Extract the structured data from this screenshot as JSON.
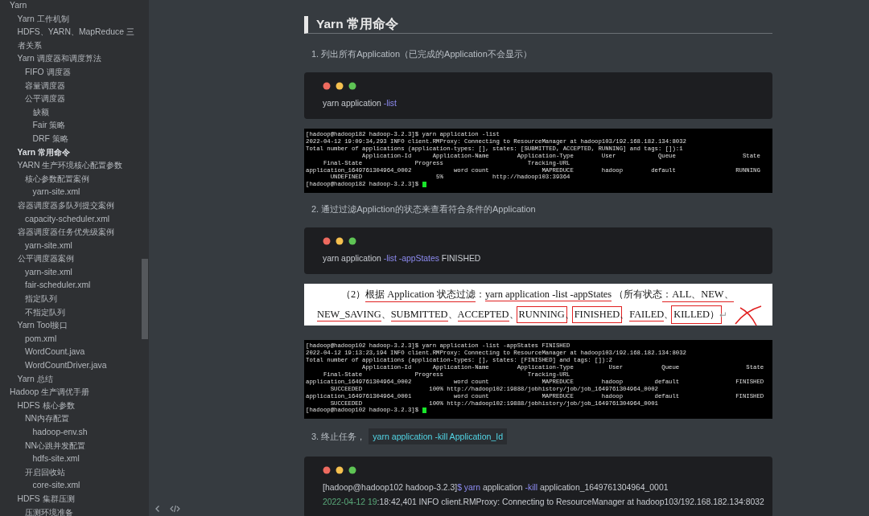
{
  "sidebar": {
    "items": [
      {
        "text": "Yarn",
        "selected": false,
        "children": [
          {
            "text": "Yarn 工作机制",
            "selected": false
          },
          {
            "text": "HDFS、YARN、MapReduce 三者关系",
            "selected": false
          },
          {
            "text": "Yarn 调度器和调度算法",
            "selected": false,
            "children": [
              {
                "text": "FIFO 调度器",
                "selected": false
              },
              {
                "text": "容量调度器",
                "selected": false
              },
              {
                "text": "公平调度器",
                "selected": false,
                "children": [
                  {
                    "text": "缺额",
                    "selected": false
                  },
                  {
                    "text": "Fair 策略",
                    "selected": false
                  },
                  {
                    "text": "DRF 策略",
                    "selected": false
                  }
                ]
              }
            ]
          },
          {
            "text": "Yarn 常用命令",
            "selected": true
          },
          {
            "text": "YARN 生产环境核心配置参数",
            "selected": false,
            "children": [
              {
                "text": "核心参数配置案例",
                "selected": false,
                "children": [
                  {
                    "text": "yarn-site.xml",
                    "selected": false
                  }
                ]
              }
            ]
          },
          {
            "text": "容器调度器多队列提交案例",
            "selected": false,
            "children": [
              {
                "text": "capacity-scheduler.xml",
                "selected": false
              }
            ]
          },
          {
            "text": "容器调度器任务优先级案例",
            "selected": false,
            "children": [
              {
                "text": "yarn-site.xml",
                "selected": false
              }
            ]
          },
          {
            "text": "公平调度器案例",
            "selected": false,
            "children": [
              {
                "text": "yarn-site.xml",
                "selected": false
              },
              {
                "text": "fair-scheduler.xml",
                "selected": false
              },
              {
                "text": "指定队列",
                "selected": false
              },
              {
                "text": "不指定队列",
                "selected": false
              }
            ]
          },
          {
            "text": "Yarn Tool接口",
            "selected": false,
            "children": [
              {
                "text": "pom.xml",
                "selected": false
              },
              {
                "text": "WordCount.java",
                "selected": false
              },
              {
                "text": "WordCountDriver.java",
                "selected": false
              }
            ]
          },
          {
            "text": "Yarn 总结",
            "selected": false
          }
        ]
      },
      {
        "text": "Hadoop 生产调优手册",
        "selected": false,
        "children": [
          {
            "text": "HDFS 核心参数",
            "selected": false,
            "children": [
              {
                "text": "NN内存配置",
                "selected": false,
                "children": [
                  {
                    "text": "hadoop-env.sh",
                    "selected": false
                  }
                ]
              },
              {
                "text": "NN心跳并发配置",
                "selected": false,
                "children": [
                  {
                    "text": "hdfs-site.xml",
                    "selected": false
                  }
                ]
              },
              {
                "text": "开启回收站",
                "selected": false,
                "children": [
                  {
                    "text": "core-site.xml",
                    "selected": false
                  }
                ]
              }
            ]
          },
          {
            "text": "HDFS 集群压测",
            "selected": false,
            "children": [
              {
                "text": "压测环境准备",
                "selected": false
              }
            ]
          }
        ]
      }
    ]
  },
  "document": {
    "blocks": [
      {
        "kind": "heading",
        "text": "Yarn 常用命令"
      },
      {
        "kind": "list_item",
        "text": "1. 列出所有Application（已完成的Application不会显示）"
      },
      {
        "kind": "code_block",
        "lines": [
          [
            {
              "text": "yarn application ",
              "kind": "plain"
            },
            {
              "text": "-list",
              "kind": "keyword"
            }
          ]
        ]
      },
      {
        "kind": "terminal",
        "cursor": true,
        "lines": [
          "[hadoop@hadoop182 hadoop-3.2.3]$ yarn application -list",
          "2022-04-12 19:09:34,293 INFO client.RMProxy: Connecting to ResourceManager at hadoop103/192.168.182.134:8032",
          "Total number of applications (application-types: [], states: [SUBMITTED, ACCEPTED, RUNNING] and tags: []):1",
          "                Application-Id      Application-Name        Application-Type        User            Queue                   State",
          "     Final-State               Progress                        Tracking-URL",
          "application_1649761304964_0002            word count               MAPREDUCE        hadoop        default                 RUNNING",
          "       UNDEFINED                     5%              http://hadoop103:39364",
          "[hadoop@hadoop182 hadoop-3.2.3]$ "
        ]
      },
      {
        "kind": "list_item",
        "text": "2. 通过过滤Appliction的状态来查看符合条件的Application"
      },
      {
        "kind": "code_block",
        "lines": [
          [
            {
              "text": "yarn application ",
              "kind": "plain"
            },
            {
              "text": "-list -appStates",
              "kind": "keyword"
            },
            {
              "text": " FINISHED",
              "kind": "plain"
            }
          ]
        ]
      },
      {
        "kind": "scanned_text",
        "cross": true,
        "lines": [
          [
            {
              "text": "（2）",
              "kind": "plain"
            },
            {
              "text": "根据 Application 状态过滤",
              "kind": "underlined"
            },
            {
              "text": "：",
              "kind": "plain"
            },
            {
              "text": "yarn application -list -appStates",
              "kind": "underlined"
            },
            {
              "text": " （所有状态",
              "kind": "plain"
            },
            {
              "text": "：ALL、NEW、",
              "kind": "underlined"
            }
          ],
          [
            {
              "text": "NEW_SAVING",
              "kind": "underlined"
            },
            {
              "text": "、",
              "kind": "plain"
            },
            {
              "text": "SUBMITTED",
              "kind": "underlined"
            },
            {
              "text": "、",
              "kind": "plain"
            },
            {
              "text": "ACCEPTED",
              "kind": "underlined"
            },
            {
              "text": "、",
              "kind": "plain"
            },
            {
              "text": "RUNNING",
              "kind": "boxed"
            },
            {
              "text": "、",
              "kind": "plain"
            },
            {
              "text": "FINISHED",
              "kind": "boxed"
            },
            {
              "text": "、",
              "kind": "plain"
            },
            {
              "text": "FAILED",
              "kind": "underlined"
            },
            {
              "text": "、",
              "kind": "plain"
            },
            {
              "text": "KILLED）",
              "kind": "boxed"
            },
            {
              "text": "↵",
              "kind": "faint"
            }
          ]
        ]
      },
      {
        "kind": "terminal",
        "cursor": true,
        "lines": [
          "[hadoop@hadoop102 hadoop-3.2.3]$ yarn application -list -appStates FINISHED",
          "2022-04-12 19:13:23,194 INFO client.RMProxy: Connecting to ResourceManager at hadoop103/192.168.182.134:8032",
          "Total number of applications (application-types: [], states: [FINISHED] and tags: []):2",
          "                Application-Id      Application-Name        Application-Type          User           Queue                   State",
          "     Final-State               Progress                        Tracking-URL",
          "application_1649761304964_0002            word count               MAPREDUCE        hadoop         default                FINISHED",
          "       SUCCEEDED                   100% http://hadoop102:19888/jobhistory/job/job_1649761304964_0002",
          "application_1649761304964_0001            word count               MAPREDUCE        hadoop         default                FINISHED",
          "       SUCCEEDED                   100% http://hadoop102:19888/jobhistory/job/job_1649761304964_0001",
          "[hadoop@hadoop102 hadoop-3.2.3]$ "
        ]
      },
      {
        "kind": "list_item",
        "text": "3. 终止任务，",
        "inline_code": "yarn application -kill Application_Id"
      },
      {
        "kind": "code_block",
        "lines": [
          [
            {
              "text": "[hadoop@hadoop102 hadoop-3.2.3]",
              "kind": "plain"
            },
            {
              "text": "$ yarn",
              "kind": "keyword"
            },
            {
              "text": " application ",
              "kind": "plain"
            },
            {
              "text": "-kill",
              "kind": "keyword"
            },
            {
              "text": " application_1649761304964_0001",
              "kind": "plain"
            }
          ],
          [
            {
              "text": "2022-04-12 19",
              "kind": "number"
            },
            {
              "text": ":18:42,401 INFO client.RMProxy: Connecting to ResourceManager at hadoop103/192.168.182.134:8032",
              "kind": "plain"
            }
          ]
        ]
      }
    ]
  }
}
